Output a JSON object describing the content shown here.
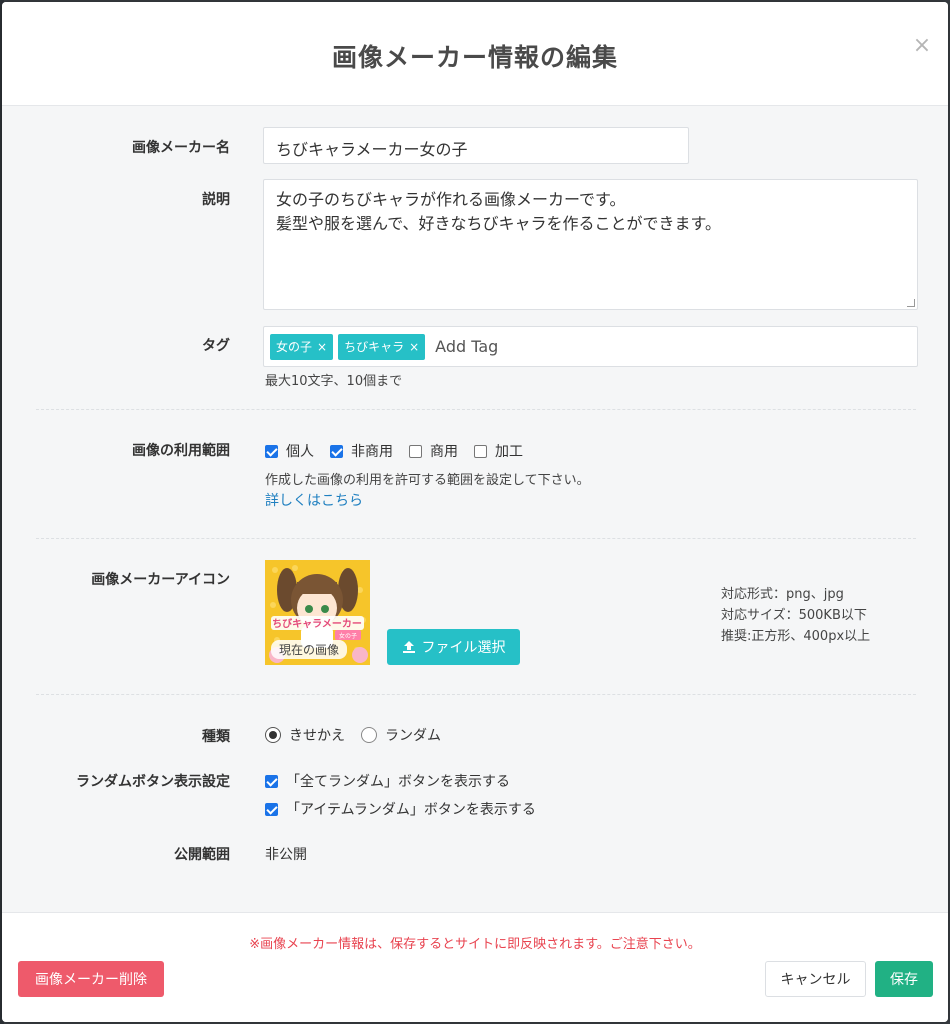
{
  "modal": {
    "title": "画像メーカー情報の編集",
    "close_symbol": "×"
  },
  "form": {
    "name": {
      "label": "画像メーカー名",
      "value": "ちびキャラメーカー女の子"
    },
    "description": {
      "label": "説明",
      "lines": [
        "女の子のちびキャラが作れる画像メーカーです。",
        "髪型や服を選んで、好きなちびキャラを作ることができます。"
      ]
    },
    "tags": {
      "label": "タグ",
      "items": [
        {
          "label": "女の子",
          "remove": "×"
        },
        {
          "label": "ちびキャラ",
          "remove": "×"
        }
      ],
      "placeholder": "Add Tag",
      "help": "最大10文字、10個まで"
    },
    "usage": {
      "label": "画像の利用範囲",
      "options": [
        {
          "label": "個人",
          "checked": true
        },
        {
          "label": "非商用",
          "checked": true
        },
        {
          "label": "商用",
          "checked": false
        },
        {
          "label": "加工",
          "checked": false
        }
      ],
      "help": "作成した画像の利用を許可する範囲を設定して下さい。",
      "link": "詳しくはこちら"
    },
    "icon": {
      "label": "画像メーカーアイコン",
      "thumb_title": "ちびキャラメーカー",
      "thumb_badge": "女の子",
      "thumb_overlay": "現在の画像",
      "file_button": "ファイル選択",
      "specs": [
        "対応形式：png、jpg",
        "対応サイズ：500KB以下",
        "推奨:正方形、400px以上"
      ]
    },
    "type": {
      "label": "種類",
      "options": [
        {
          "label": "きせかえ",
          "selected": true
        },
        {
          "label": "ランダム",
          "selected": false
        }
      ]
    },
    "random_buttons": {
      "label": "ランダムボタン表示設定",
      "options": [
        {
          "label": "「全てランダム」ボタンを表示する",
          "checked": true
        },
        {
          "label": "「アイテムランダム」ボタンを表示する",
          "checked": true
        }
      ]
    },
    "visibility": {
      "label": "公開範囲",
      "value": "非公開"
    }
  },
  "footer": {
    "warning": "※画像メーカー情報は、保存するとサイトに即反映されます。ご注意下さい。",
    "delete_button": "画像メーカー削除",
    "cancel_button": "キャンセル",
    "save_button": "保存"
  },
  "colors": {
    "accent_teal": "#26c0c7",
    "save_green": "#21b184",
    "delete_red": "#ee5a6b",
    "warning_red": "#e8434f",
    "link_blue": "#1e7fc0"
  }
}
